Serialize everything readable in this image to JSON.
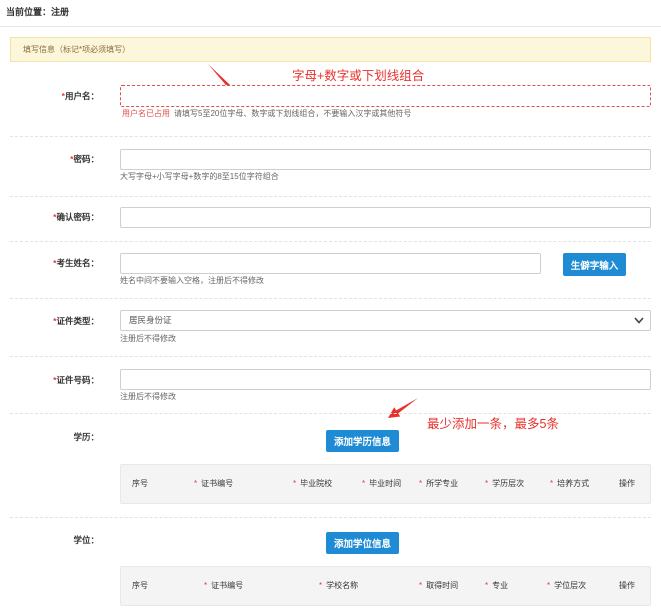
{
  "breadcrumb": {
    "text": "当前位置：注册"
  },
  "notice": {
    "text": "填写信息（标记*项必须填写）"
  },
  "annotations": {
    "username_tip": "字母+数字或下划线组合",
    "education_tip": "最少添加一条，最多5条"
  },
  "form": {
    "username": {
      "mark": "*",
      "label": "用户名：",
      "value": "",
      "error": "用户名已占用",
      "hint": "请填写5至20位字母、数字或下划线组合，不要输入汉字或其他符号"
    },
    "password": {
      "mark": "*",
      "label": "密码：",
      "value": "",
      "hint": "大写字母+小写字母+数字的8至15位字符组合"
    },
    "confirm_password": {
      "mark": "*",
      "label": "确认密码：",
      "value": ""
    },
    "name": {
      "mark": "*",
      "label": "考生姓名：",
      "value": "",
      "hint": "姓名中间不要输入空格，注册后不得修改",
      "rare_char_button": "生僻字输入"
    },
    "id_type": {
      "mark": "*",
      "label": "证件类型：",
      "selected": "居民身份证",
      "hint": "注册后不得修改",
      "icon": "chevron-down-icon"
    },
    "id_number": {
      "mark": "*",
      "label": "证件号码：",
      "value": "",
      "hint": "注册后不得修改"
    },
    "education": {
      "label": "学历：",
      "add_button": "添加学历信息",
      "columns": [
        {
          "label": "序号"
        },
        {
          "mark": "*",
          "label": "证书编号"
        },
        {
          "mark": "*",
          "label": "毕业院校"
        },
        {
          "mark": "*",
          "label": "毕业时间"
        },
        {
          "mark": "*",
          "label": "所学专业"
        },
        {
          "mark": "*",
          "label": "学历层次"
        },
        {
          "mark": "*",
          "label": "培养方式"
        },
        {
          "label": "操作"
        }
      ]
    },
    "degree": {
      "label": "学位：",
      "add_button": "添加学位信息",
      "columns": [
        {
          "label": "序号"
        },
        {
          "mark": "*",
          "label": "证书编号"
        },
        {
          "mark": "*",
          "label": "学校名称"
        },
        {
          "mark": "*",
          "label": "取得时间"
        },
        {
          "mark": "*",
          "label": "专业"
        },
        {
          "mark": "*",
          "label": "学位层次"
        },
        {
          "label": "操作"
        }
      ]
    }
  },
  "colors": {
    "accent": "#1e8bd4",
    "required": "#e4393c",
    "error": "#e0504c",
    "annotation": "#e8312c",
    "notice_bg": "#fcf6da",
    "notice_border": "#f3e2a6",
    "notice_text": "#8a6d3b"
  }
}
